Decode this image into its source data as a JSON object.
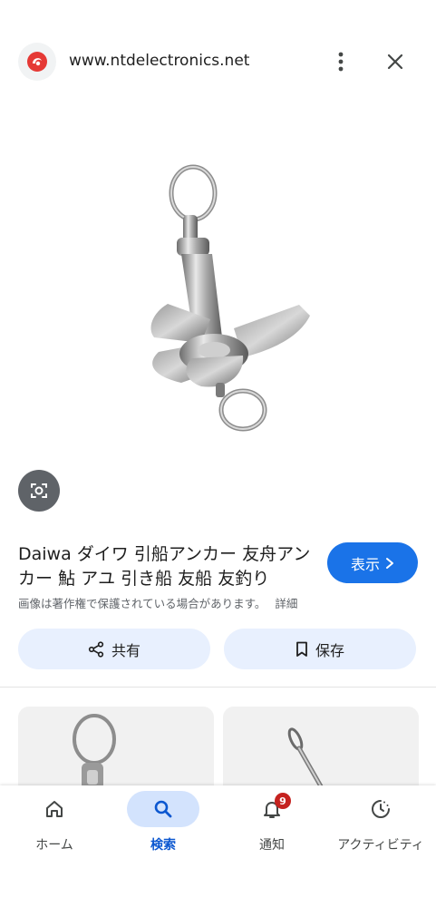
{
  "site": {
    "url": "www.ntdelectronics.net",
    "icon": "ntd-logo-icon"
  },
  "product": {
    "title": "Daiwa ダイワ 引船アンカー 友舟アンカー 鮎 アユ 引き船 友船 友釣り",
    "visit_label": "表示",
    "copyright_notice": "画像は著作権で保護されている場合があります。",
    "details_label": "詳細"
  },
  "actions": {
    "share_label": "共有",
    "save_label": "保存"
  },
  "nav": {
    "items": [
      {
        "label": "ホーム",
        "icon": "home-icon"
      },
      {
        "label": "検索",
        "icon": "search-icon"
      },
      {
        "label": "通知",
        "icon": "bell-icon",
        "badge": "9"
      },
      {
        "label": "アクティビティ",
        "icon": "activity-icon"
      }
    ]
  },
  "colors": {
    "accent": "#1a73e8",
    "active_nav": "#0b57d0",
    "badge": "#c5221f",
    "chip_bg": "#e8f0fe"
  }
}
